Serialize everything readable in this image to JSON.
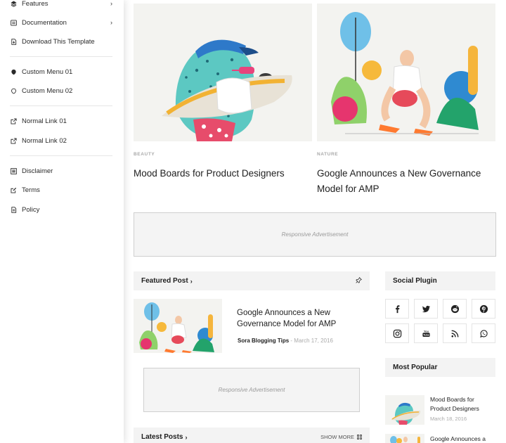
{
  "sidebar": {
    "items": [
      {
        "label": "Features",
        "icon": "layers-icon",
        "has_chevron": true
      },
      {
        "label": "Documentation",
        "icon": "document-icon",
        "has_chevron": true
      },
      {
        "label": "Download This Template",
        "icon": "download-icon",
        "has_chevron": false
      },
      {
        "label": "Custom Menu 01",
        "icon": "custom-menu-icon",
        "has_chevron": false
      },
      {
        "label": "Custom Menu 02",
        "icon": "custom-menu-icon",
        "has_chevron": false
      },
      {
        "label": "Normal Link 01",
        "icon": "external-link-icon",
        "has_chevron": false
      },
      {
        "label": "Normal Link 02",
        "icon": "external-link-icon",
        "has_chevron": false
      },
      {
        "label": "Disclaimer",
        "icon": "list-icon",
        "has_chevron": false
      },
      {
        "label": "Terms",
        "icon": "edit-icon",
        "has_chevron": false
      },
      {
        "label": "Policy",
        "icon": "file-icon",
        "has_chevron": false
      }
    ],
    "chevron": "›"
  },
  "posts": [
    {
      "category": "BEAUTY",
      "title": "Mood Boards for Product Designers"
    },
    {
      "category": "NATURE",
      "title": "Google Announces a New Governance Model for AMP"
    }
  ],
  "ads": {
    "top": "Responsive Advertisement",
    "middle": "Responsive Advertisement"
  },
  "featured": {
    "heading": "Featured Post",
    "heading_arrow": "›",
    "title": "Google Announces a New Governance Model for AMP",
    "author": "Sora Blogging Tips",
    "separator": " - ",
    "date": "March 17, 2016"
  },
  "latest": {
    "heading": "Latest Posts",
    "heading_arrow": "›",
    "show_more": "SHOW MORE"
  },
  "social": {
    "heading": "Social Plugin",
    "icons": [
      "facebook-icon",
      "twitter-icon",
      "reddit-icon",
      "pinterest-icon",
      "instagram-icon",
      "youtube-icon",
      "rss-icon",
      "whatsapp-icon"
    ]
  },
  "popular": {
    "heading": "Most Popular",
    "items": [
      {
        "title": "Mood Boards for Product Designers",
        "date": "March 18, 2016"
      },
      {
        "title": "Google Announces a",
        "date": ""
      }
    ]
  },
  "colors": {
    "text": "#1e1e1e",
    "muted": "#aaaaaa",
    "widget_bg": "#f3f3f3",
    "ad_bg": "#f4f4f4"
  }
}
